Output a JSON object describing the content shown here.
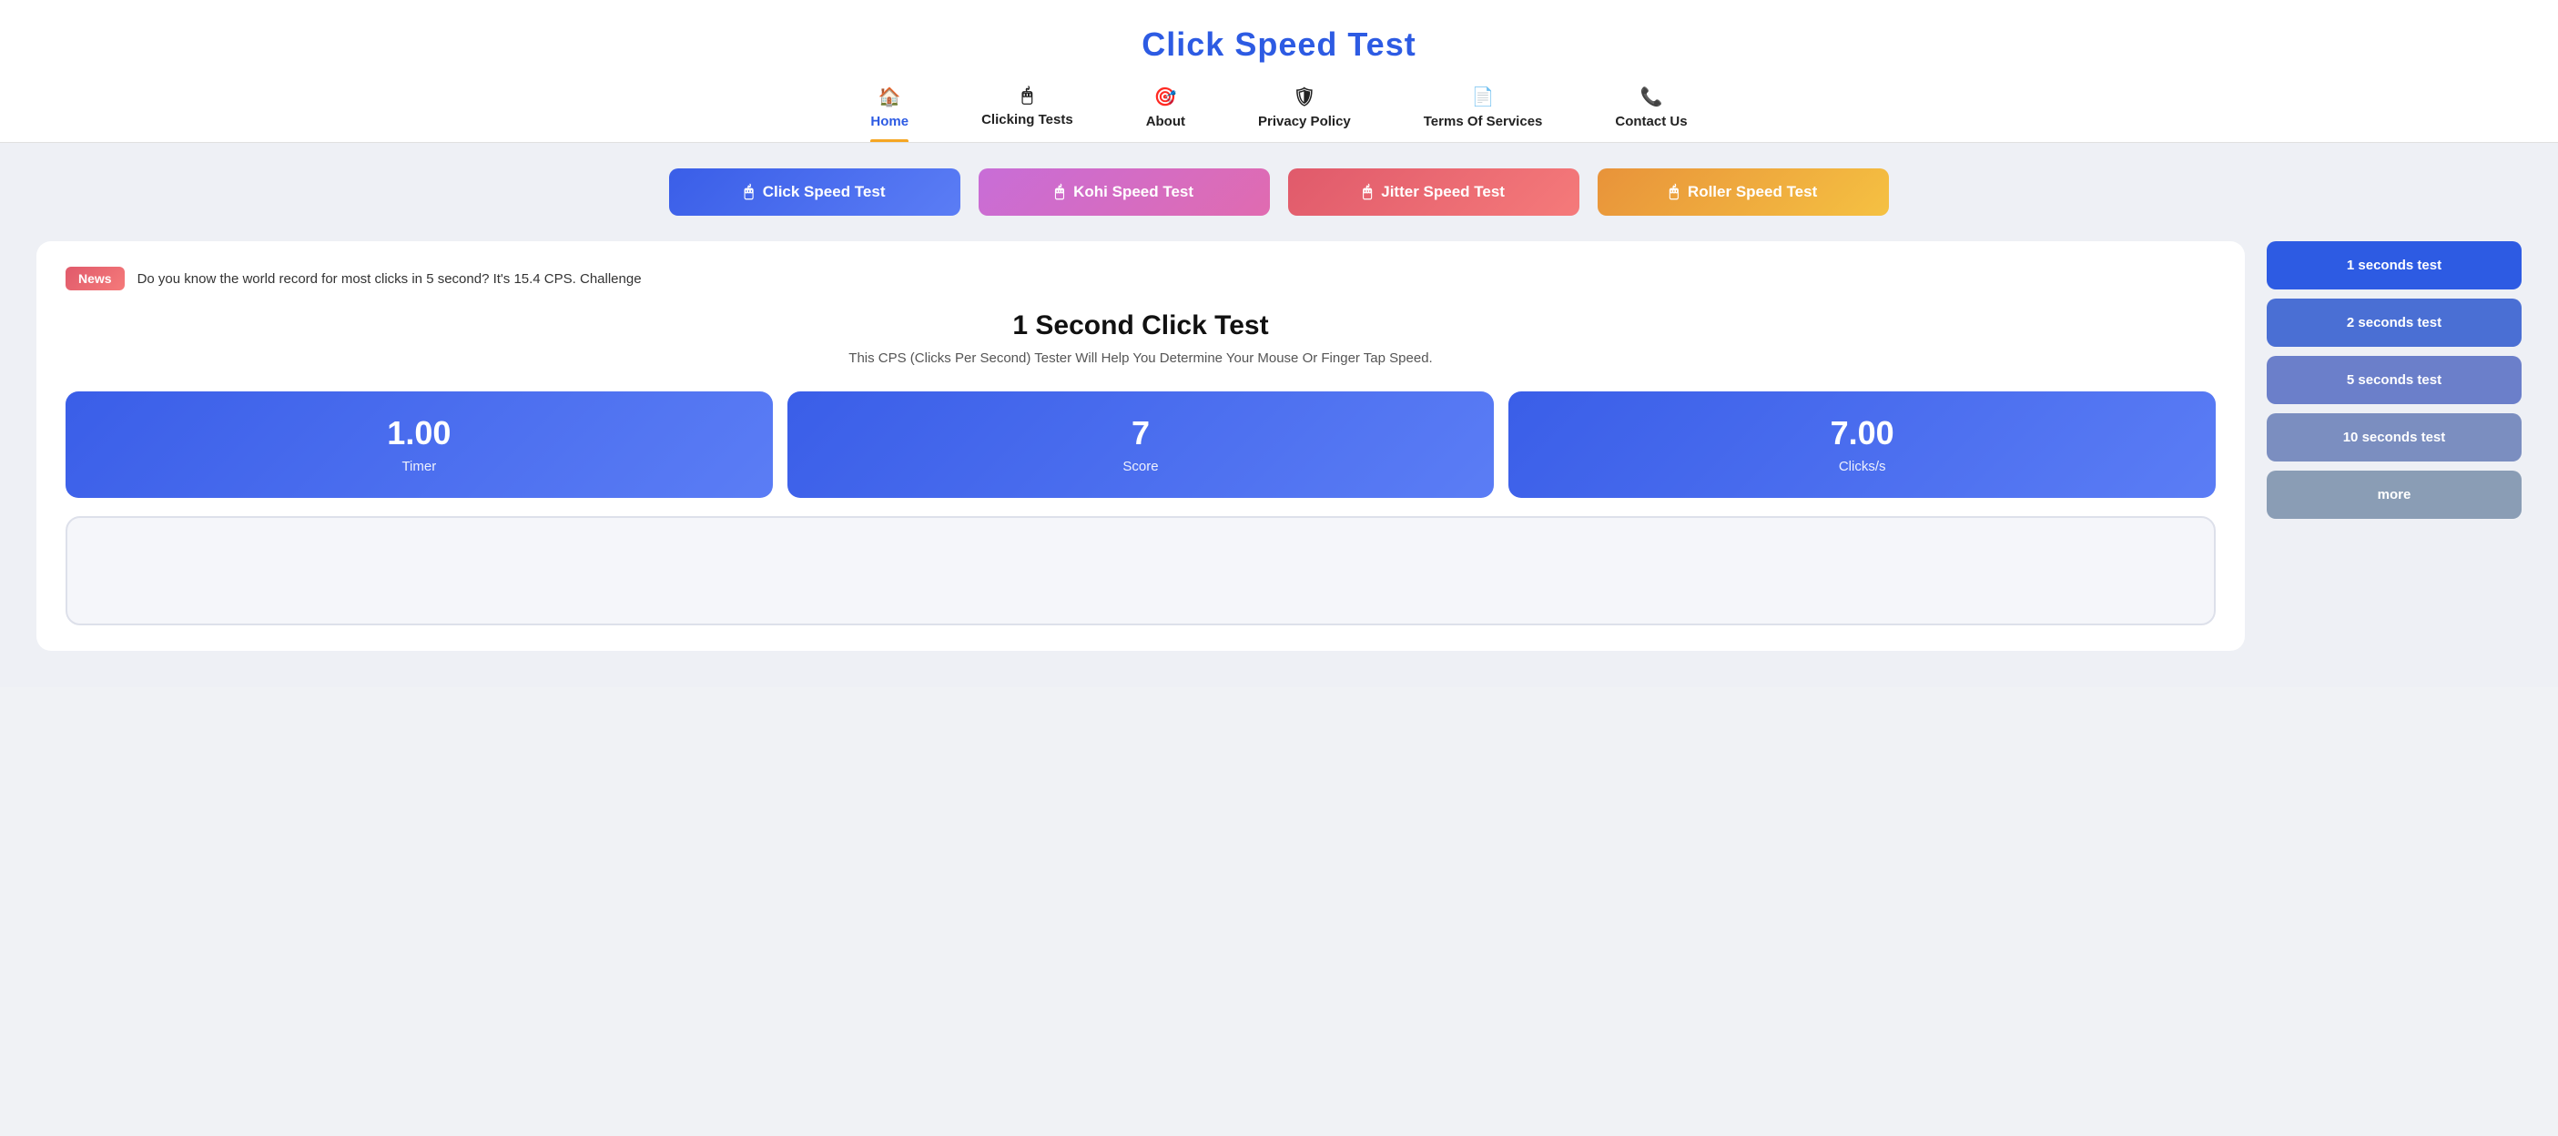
{
  "header": {
    "site_title": "Click Speed Test"
  },
  "nav": {
    "items": [
      {
        "id": "home",
        "label": "Home",
        "icon": "🏠",
        "active": true
      },
      {
        "id": "clicking-tests",
        "label": "Clicking Tests",
        "icon": "🖱",
        "active": false
      },
      {
        "id": "about",
        "label": "About",
        "icon": "🎯",
        "active": false
      },
      {
        "id": "privacy-policy",
        "label": "Privacy Policy",
        "icon": "🛡",
        "active": false
      },
      {
        "id": "terms-of-services",
        "label": "Terms Of Services",
        "icon": "🗒",
        "active": false
      },
      {
        "id": "contact-us",
        "label": "Contact Us",
        "icon": "📞",
        "active": false
      }
    ]
  },
  "banner_buttons": [
    {
      "id": "click-speed-test",
      "label": "Click Speed Test",
      "style": "btn-blue"
    },
    {
      "id": "kohi-speed-test",
      "label": "Kohi Speed Test",
      "style": "btn-pink"
    },
    {
      "id": "jitter-speed-test",
      "label": "Jitter Speed Test",
      "style": "btn-red"
    },
    {
      "id": "roller-speed-test",
      "label": "Roller Speed Test",
      "style": "btn-orange"
    }
  ],
  "news": {
    "badge": "News",
    "text": "Do you know the world record for most clicks in 5 second? It's 15.4 CPS. Challenge"
  },
  "test": {
    "title": "1 Second Click Test",
    "subtitle": "This CPS (Clicks Per Second) Tester Will Help You Determine Your Mouse Or Finger Tap Speed."
  },
  "stats": [
    {
      "id": "timer",
      "value": "1.00",
      "label": "Timer"
    },
    {
      "id": "score",
      "value": "7",
      "label": "Score"
    },
    {
      "id": "clicks-per-second",
      "value": "7.00",
      "label": "Clicks/s"
    }
  ],
  "sidebar_buttons": [
    {
      "id": "btn-1s",
      "label": "1 seconds test",
      "style": "sidebar-btn-1"
    },
    {
      "id": "btn-2s",
      "label": "2 seconds test",
      "style": "sidebar-btn-2"
    },
    {
      "id": "btn-5s",
      "label": "5 seconds test",
      "style": "sidebar-btn-5"
    },
    {
      "id": "btn-10s",
      "label": "10 seconds test",
      "style": "sidebar-btn-10"
    },
    {
      "id": "btn-more",
      "label": "more",
      "style": "sidebar-btn-more"
    }
  ],
  "icons": {
    "home": "🏠",
    "mouse": "🖱",
    "target": "🎯",
    "shield": "🛡",
    "document": "📄",
    "phone": "📞"
  }
}
